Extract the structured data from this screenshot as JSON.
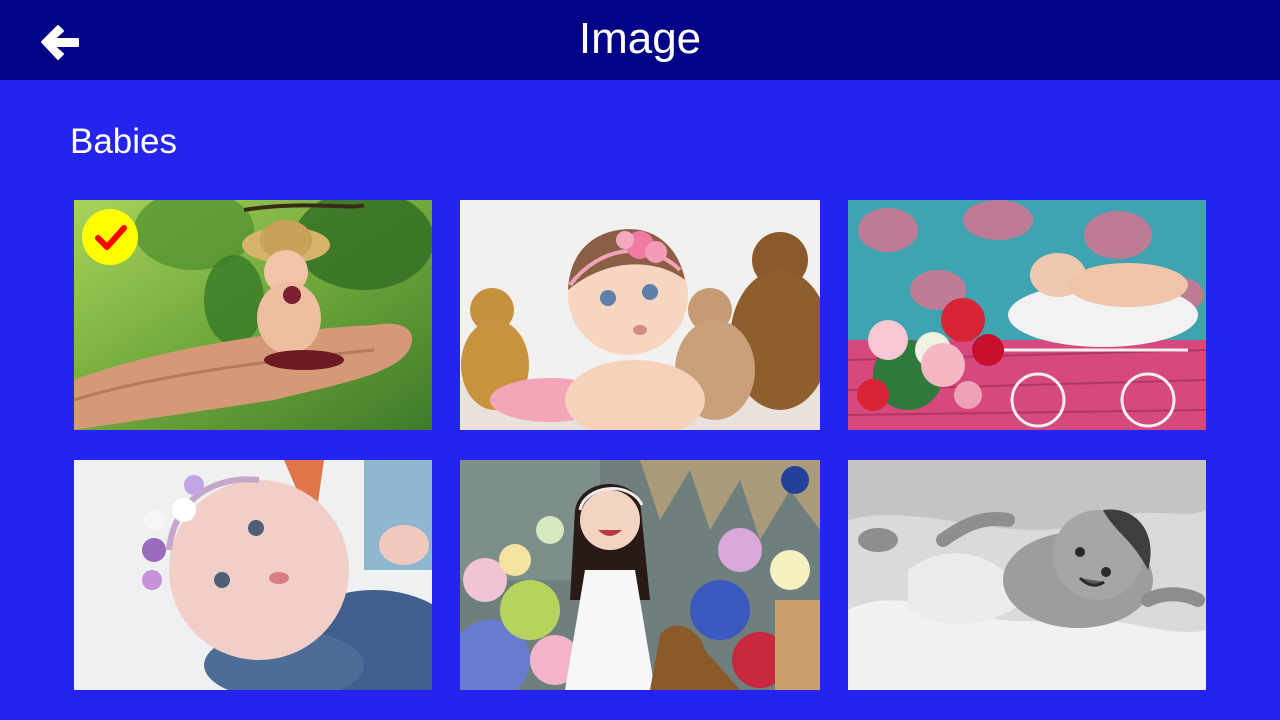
{
  "header": {
    "title": "Image",
    "back_icon": "arrow-left-icon"
  },
  "section": {
    "title": "Babies"
  },
  "gallery": {
    "selected_index": 0,
    "selection_icon": "checkmark-icon",
    "selection_color": "#ffff00",
    "check_color": "#ff0000"
  },
  "colors": {
    "header_bg": "#020387",
    "page_bg": "#2424ee",
    "text": "#ffffff"
  }
}
